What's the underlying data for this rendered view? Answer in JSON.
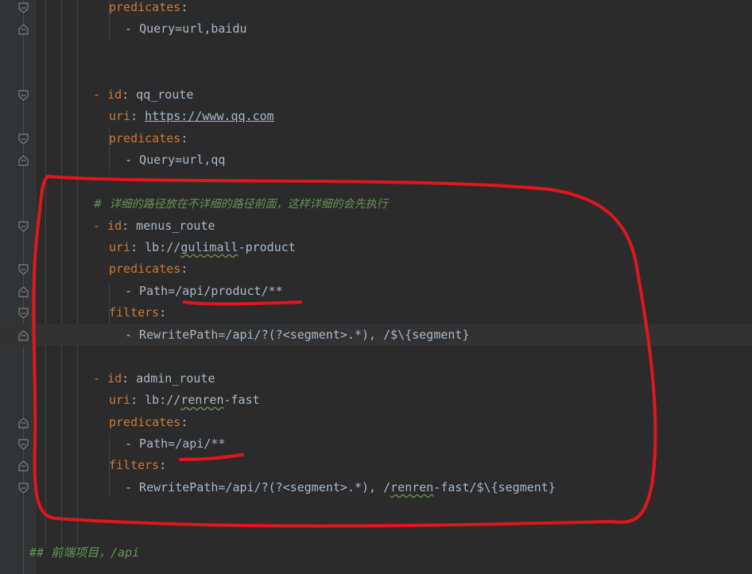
{
  "editor": {
    "lines": [
      {
        "indent": 137,
        "parts": [
          {
            "t": "predicates",
            "c": "key"
          },
          {
            "t": ":",
            "c": "val"
          }
        ]
      },
      {
        "indent": 157,
        "parts": [
          {
            "t": "- ",
            "c": "val"
          },
          {
            "t": "Query=url,baidu",
            "c": "val"
          }
        ]
      },
      {
        "indent": 117,
        "parts": []
      },
      {
        "indent": 117,
        "parts": []
      },
      {
        "indent": 117,
        "parts": [
          {
            "t": "- ",
            "c": "dash"
          },
          {
            "t": "id",
            "c": "key"
          },
          {
            "t": ": qq_route",
            "c": "val"
          }
        ]
      },
      {
        "indent": 137,
        "parts": [
          {
            "t": "uri",
            "c": "key"
          },
          {
            "t": ": ",
            "c": "val"
          },
          {
            "t": "https://www.qq.com",
            "c": "link"
          }
        ]
      },
      {
        "indent": 137,
        "parts": [
          {
            "t": "predicates",
            "c": "key"
          },
          {
            "t": ":",
            "c": "val"
          }
        ]
      },
      {
        "indent": 157,
        "parts": [
          {
            "t": "- Query=url,qq",
            "c": "val"
          }
        ]
      },
      {
        "indent": 117,
        "parts": []
      },
      {
        "indent": 117,
        "parts": [
          {
            "t": "#  详细的路径放在不详细的路径前面，这样详细的会先执行",
            "c": "comment"
          }
        ]
      },
      {
        "indent": 117,
        "parts": [
          {
            "t": "- ",
            "c": "dash"
          },
          {
            "t": "id",
            "c": "key"
          },
          {
            "t": ": menus_route",
            "c": "val"
          }
        ]
      },
      {
        "indent": 137,
        "parts": [
          {
            "t": "uri",
            "c": "key"
          },
          {
            "t": ": lb://",
            "c": "val"
          },
          {
            "t": "gulimall",
            "c": "squig"
          },
          {
            "t": "-product",
            "c": "val"
          }
        ]
      },
      {
        "indent": 137,
        "parts": [
          {
            "t": "predicates",
            "c": "key"
          },
          {
            "t": ":",
            "c": "val"
          }
        ]
      },
      {
        "indent": 157,
        "parts": [
          {
            "t": "- Path=/api/product/**",
            "c": "val"
          }
        ]
      },
      {
        "indent": 137,
        "parts": [
          {
            "t": "filters",
            "c": "key"
          },
          {
            "t": ":",
            "c": "val"
          }
        ]
      },
      {
        "indent": 157,
        "parts": [
          {
            "t": "- RewritePath=/api/?(?<segment>.*), /$\\{segment}",
            "c": "val"
          }
        ],
        "current": true
      },
      {
        "indent": 117,
        "parts": []
      },
      {
        "indent": 117,
        "parts": [
          {
            "t": "- ",
            "c": "dash"
          },
          {
            "t": "id",
            "c": "key"
          },
          {
            "t": ": admin_route",
            "c": "val"
          }
        ]
      },
      {
        "indent": 137,
        "parts": [
          {
            "t": "uri",
            "c": "key"
          },
          {
            "t": ": lb://",
            "c": "val"
          },
          {
            "t": "renren",
            "c": "squig"
          },
          {
            "t": "-fast",
            "c": "val"
          }
        ]
      },
      {
        "indent": 137,
        "parts": [
          {
            "t": "predicates",
            "c": "key"
          },
          {
            "t": ":",
            "c": "val"
          }
        ]
      },
      {
        "indent": 157,
        "parts": [
          {
            "t": "- Path=/api/**",
            "c": "val"
          }
        ]
      },
      {
        "indent": 137,
        "parts": [
          {
            "t": "filters",
            "c": "key"
          },
          {
            "t": ":",
            "c": "val"
          }
        ]
      },
      {
        "indent": 157,
        "parts": [
          {
            "t": "- RewritePath=/api/?(?<segment>.*), /",
            "c": "val"
          },
          {
            "t": "renren",
            "c": "squig"
          },
          {
            "t": "-fast/$\\{segment}",
            "c": "val"
          }
        ]
      },
      {
        "indent": 117,
        "parts": []
      },
      {
        "indent": 117,
        "parts": []
      },
      {
        "indent": 37,
        "parts": [
          {
            "t": "## ",
            "c": "md"
          },
          {
            "t": "前端项目，/api",
            "c": "md"
          }
        ]
      }
    ]
  },
  "annotations": {
    "box_color": "#e0161c",
    "underline_color": "#e0161c"
  }
}
